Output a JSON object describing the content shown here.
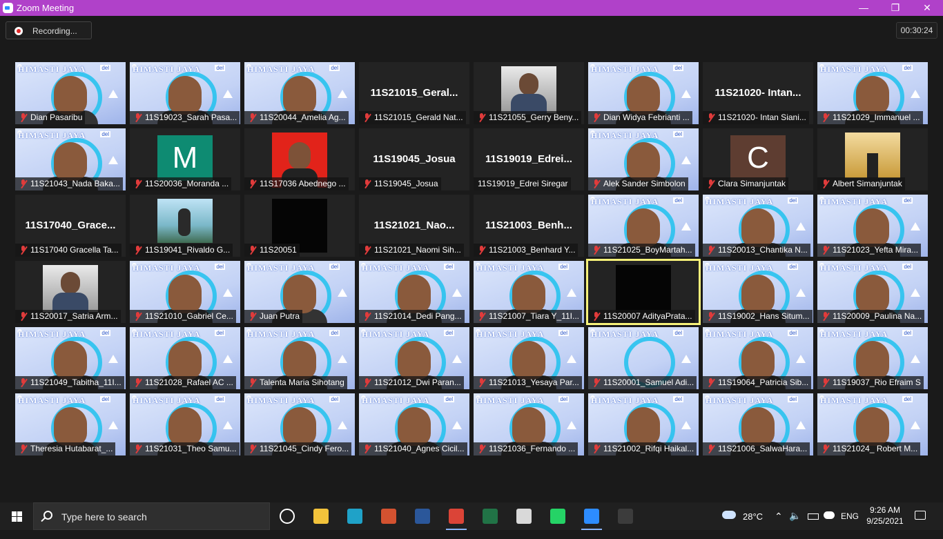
{
  "window": {
    "title": "Zoom Meeting",
    "minimize": "—",
    "restore": "❐",
    "close": "✕"
  },
  "recording": {
    "label": "Recording..."
  },
  "timer": "00:30:24",
  "video_banner": {
    "text": "HIMASTI JAYA",
    "logo": "del"
  },
  "participants": [
    {
      "big": "",
      "name": "Dian Pasaribu",
      "muted": true,
      "type": "video"
    },
    {
      "big": "",
      "name": "11S19023_Sarah Pasa...",
      "muted": true,
      "type": "video"
    },
    {
      "big": "",
      "name": "11S20044_Amelia Ag...",
      "muted": true,
      "type": "video"
    },
    {
      "big": "11S21015_Geral...",
      "name": "11S21015_Gerald Nat...",
      "muted": true,
      "type": "text"
    },
    {
      "big": "",
      "name": "11S21055_Gerry Beny...",
      "muted": true,
      "type": "photo"
    },
    {
      "big": "",
      "name": "Dian Widya Febrianti ...",
      "muted": true,
      "type": "video"
    },
    {
      "big": "11S21020- Intan...",
      "name": "11S21020- Intan Siani...",
      "muted": true,
      "type": "text"
    },
    {
      "big": "",
      "name": "11S21029_Immanuel ...",
      "muted": true,
      "type": "video"
    },
    {
      "big": "",
      "name": "11S21043_Nada Baka...",
      "muted": true,
      "type": "video"
    },
    {
      "big": "M",
      "name": "11S20036_Moranda ...",
      "muted": true,
      "type": "avatar",
      "color": "#0e8b72"
    },
    {
      "big": "",
      "name": "11S17036 Abednego ...",
      "muted": true,
      "type": "photo-red"
    },
    {
      "big": "11S19045_Josua",
      "name": "11S19045_Josua",
      "muted": true,
      "type": "text"
    },
    {
      "big": "11S19019_Edrei...",
      "name": "11S19019_Edrei Siregar",
      "muted": false,
      "type": "text"
    },
    {
      "big": "",
      "name": "Alek Sander Simbolon",
      "muted": true,
      "type": "video"
    },
    {
      "big": "C",
      "name": "Clara Simanjuntak",
      "muted": true,
      "type": "avatar",
      "color": "#5e3d31"
    },
    {
      "big": "",
      "name": "Albert Simanjuntak",
      "muted": true,
      "type": "photo-gold"
    },
    {
      "big": "11S17040_Grace...",
      "name": "11S17040 Gracella Ta...",
      "muted": true,
      "type": "text"
    },
    {
      "big": "",
      "name": "11S19041_Rivaldo G...",
      "muted": true,
      "type": "photo-sky"
    },
    {
      "big": "",
      "name": "11S20051",
      "muted": true,
      "type": "black"
    },
    {
      "big": "11S21021_Nao...",
      "name": "11S21021_Naomi Sih...",
      "muted": true,
      "type": "text"
    },
    {
      "big": "11S21003_Benh...",
      "name": "11S21003_Benhard Y...",
      "muted": true,
      "type": "text"
    },
    {
      "big": "",
      "name": "11S21025_BoyMartah...",
      "muted": true,
      "type": "video"
    },
    {
      "big": "",
      "name": "11S20013_Chantika N...",
      "muted": true,
      "type": "video"
    },
    {
      "big": "",
      "name": "11S21023_Yefta Mira...",
      "muted": true,
      "type": "video"
    },
    {
      "big": "",
      "name": "11S20017_Satria Arm...",
      "muted": true,
      "type": "photo"
    },
    {
      "big": "",
      "name": "11S21010_Gabriel Ce...",
      "muted": true,
      "type": "video"
    },
    {
      "big": "",
      "name": "Juan Putra",
      "muted": true,
      "type": "video"
    },
    {
      "big": "",
      "name": "11S21014_Dedi Pang...",
      "muted": true,
      "type": "video"
    },
    {
      "big": "",
      "name": "11S21007_Tiara Y_11I...",
      "muted": true,
      "type": "video"
    },
    {
      "big": "",
      "name": "11S20007 AdityaPrata...",
      "muted": true,
      "type": "black",
      "active": true
    },
    {
      "big": "",
      "name": "11S19002_Hans Situm...",
      "muted": true,
      "type": "video"
    },
    {
      "big": "",
      "name": "11S20009_Paulina Na...",
      "muted": true,
      "type": "video"
    },
    {
      "big": "",
      "name": "11S21049_Tabitha_11I...",
      "muted": true,
      "type": "video"
    },
    {
      "big": "",
      "name": "11S21028_Rafael AC ...",
      "muted": true,
      "type": "video"
    },
    {
      "big": "",
      "name": "Talenta Maria Sihotang",
      "muted": true,
      "type": "video"
    },
    {
      "big": "",
      "name": "11S21012_Dwi Paran...",
      "muted": true,
      "type": "video"
    },
    {
      "big": "",
      "name": "11S21013_Yesaya Par...",
      "muted": true,
      "type": "video"
    },
    {
      "big": "",
      "name": "11S20001_Samuel Adi...",
      "muted": true,
      "type": "video-empty"
    },
    {
      "big": "",
      "name": "11S19064_Patricia Sib...",
      "muted": true,
      "type": "video"
    },
    {
      "big": "",
      "name": "11S19037_Rio Efraim S",
      "muted": true,
      "type": "video"
    },
    {
      "big": "",
      "name": "Theresia Hutabarat_...",
      "muted": true,
      "type": "video"
    },
    {
      "big": "",
      "name": "11S21031_Theo Samu...",
      "muted": true,
      "type": "video"
    },
    {
      "big": "",
      "name": "11S21045_Cindy Fero...",
      "muted": true,
      "type": "video"
    },
    {
      "big": "",
      "name": "11S21040_Agnes Cicil...",
      "muted": true,
      "type": "video"
    },
    {
      "big": "",
      "name": "11S21036_Fernando ...",
      "muted": true,
      "type": "video"
    },
    {
      "big": "",
      "name": "11S21002_Rifqi Haikal...",
      "muted": true,
      "type": "video"
    },
    {
      "big": "",
      "name": "11S21006_SalwaHara...",
      "muted": true,
      "type": "video"
    },
    {
      "big": "",
      "name": "11S21024_ Robert M...",
      "muted": true,
      "type": "video"
    }
  ],
  "taskbar": {
    "search_placeholder": "Type here to search",
    "apps": [
      {
        "icon": "task-view-icon",
        "color": "#ffffff"
      },
      {
        "icon": "file-explorer-icon",
        "color": "#f3c33b"
      },
      {
        "icon": "edge-icon",
        "color": "#1fa2c8"
      },
      {
        "icon": "powerpoint-icon",
        "color": "#d35230"
      },
      {
        "icon": "word-icon",
        "color": "#2b579a"
      },
      {
        "icon": "chrome-icon",
        "color": "#db4437"
      },
      {
        "icon": "excel-icon",
        "color": "#217346"
      },
      {
        "icon": "paint-icon",
        "color": "#d9d9d9"
      },
      {
        "icon": "whatsapp-icon",
        "color": "#25d366"
      },
      {
        "icon": "zoom-icon",
        "color": "#2d8cff"
      },
      {
        "icon": "obs-icon",
        "color": "#3c3c3c"
      }
    ],
    "weather": "28°C",
    "language": "ENG",
    "time": "9:26 AM",
    "date": "9/25/2021"
  }
}
